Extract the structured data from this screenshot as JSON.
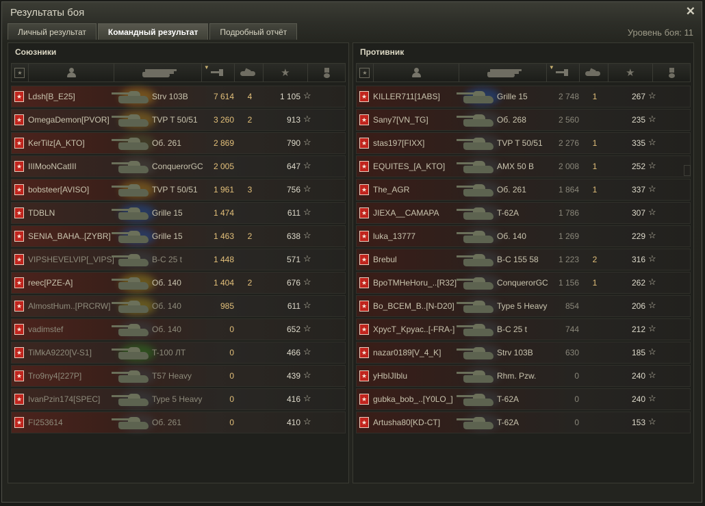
{
  "window": {
    "title": "Результаты боя",
    "close": "✕",
    "level": "Уровень боя: 11"
  },
  "tabs": [
    {
      "label": "Личный результат"
    },
    {
      "label": "Командный результат"
    },
    {
      "label": "Подробный отчёт"
    }
  ],
  "allies": {
    "title": "Союзники",
    "rows": [
      {
        "player": "Ldsh[B_E25]",
        "tank": "Strv 103B",
        "damage": "7 614",
        "kills": "4",
        "xp": "1 105",
        "glow": "#b08020"
      },
      {
        "player": "OmegaDemon[PVOR]",
        "tank": "TVP T 50/51",
        "damage": "3 260",
        "kills": "2",
        "xp": "913",
        "glow": "#a07a20"
      },
      {
        "player": "KerTilz[A_KTO]",
        "tank": "Об. 261",
        "damage": "2 869",
        "kills": "",
        "xp": "790",
        "glow": "#4a5530"
      },
      {
        "player": "IIIMooNCatIII",
        "tank": "ConquerorGC",
        "damage": "2 005",
        "kills": "",
        "xp": "647",
        "glow": "#4a4a44"
      },
      {
        "player": "bobsteer[AVISO]",
        "tank": "TVP T 50/51",
        "damage": "1 961",
        "kills": "3",
        "xp": "756",
        "glow": "#a07a20"
      },
      {
        "player": "TDBLN",
        "tank": "Grille 15",
        "damage": "1 474",
        "kills": "",
        "xp": "611",
        "glow": "#2050a0"
      },
      {
        "player": "SENIA_BAHA..[ZYBR]",
        "tank": "Grille 15",
        "damage": "1 463",
        "kills": "2",
        "xp": "638",
        "glow": "#2050a0"
      },
      {
        "player": "VIPSHEVELVIP[_VIPS]",
        "tank": "B-C 25 t",
        "damage": "1 448",
        "kills": "",
        "xp": "571",
        "glow": "#3a3f44",
        "dim": true
      },
      {
        "player": "reec[PZE-A]",
        "tank": "Об. 140",
        "damage": "1 404",
        "kills": "2",
        "xp": "676",
        "glow": "#9a8a20"
      },
      {
        "player": "AlmostHum..[PRCRW]",
        "tank": "Об. 140",
        "damage": "985",
        "kills": "",
        "xp": "611",
        "glow": "#9a8a20",
        "dim": true
      },
      {
        "player": "vadimstef",
        "tank": "Об. 140",
        "damage": "0",
        "kills": "",
        "xp": "652",
        "glow": "#3a3f44",
        "dim": true
      },
      {
        "player": "TiMkA9220[V-S1]",
        "tank": "T-100 ЛТ",
        "damage": "0",
        "kills": "",
        "xp": "466",
        "glow": "#307a20",
        "dim": true
      },
      {
        "player": "Tro9ny4[227P]",
        "tank": "T57 Heavy",
        "damage": "0",
        "kills": "",
        "xp": "439",
        "glow": "#3a3f44",
        "dim": true
      },
      {
        "player": "IvanPzin174[SPEC]",
        "tank": "Type 5 Heavy",
        "damage": "0",
        "kills": "",
        "xp": "416",
        "glow": "#3a3f44",
        "dim": true
      },
      {
        "player": "FI253614",
        "tank": "Об. 261",
        "damage": "0",
        "kills": "",
        "xp": "410",
        "glow": "#3a3f44",
        "dim": true
      }
    ]
  },
  "enemies": {
    "title": "Противник",
    "rows": [
      {
        "player": "KILLER711[1ABS]",
        "tank": "Grille 15",
        "damage": "2 748",
        "kills": "1",
        "xp": "267",
        "glow": "#2050a0"
      },
      {
        "player": "Sany7[VN_TG]",
        "tank": "Об. 268",
        "damage": "2 560",
        "kills": "",
        "xp": "235",
        "glow": "#3a3f44"
      },
      {
        "player": "stas197[FIXX]",
        "tank": "TVP T 50/51",
        "damage": "2 276",
        "kills": "1",
        "xp": "335",
        "glow": "#3a3f44"
      },
      {
        "player": "EQUITES_[A_KTO]",
        "tank": "AMX 50 B",
        "damage": "2 008",
        "kills": "1",
        "xp": "252",
        "glow": "#3a3f44"
      },
      {
        "player": "The_AGR",
        "tank": "Об. 261",
        "damage": "1 864",
        "kills": "1",
        "xp": "337",
        "glow": "#3a3f44"
      },
      {
        "player": "JIEXA__CAMAPA",
        "tank": "T-62A",
        "damage": "1 786",
        "kills": "",
        "xp": "307",
        "glow": "#3a3f44"
      },
      {
        "player": "luka_13777",
        "tank": "Об. 140",
        "damage": "1 269",
        "kills": "",
        "xp": "229",
        "glow": "#3a3f44"
      },
      {
        "player": "Brebul",
        "tank": "B-C 155 58",
        "damage": "1 223",
        "kills": "2",
        "xp": "316",
        "glow": "#3a3f44"
      },
      {
        "player": "BpoTMHeHoru_..[R32]",
        "tank": "ConquerorGC",
        "damage": "1 156",
        "kills": "1",
        "xp": "262",
        "glow": "#3a3f44"
      },
      {
        "player": "Bo_BCEM_B..[N-D20]",
        "tank": "Type 5 Heavy",
        "damage": "854",
        "kills": "",
        "xp": "206",
        "glow": "#3a3f44"
      },
      {
        "player": "XpycT_Kpyac..[-FRA-]",
        "tank": "B-C 25 t",
        "damage": "744",
        "kills": "",
        "xp": "212",
        "glow": "#3a3f44"
      },
      {
        "player": "nazar0189[V_4_K]",
        "tank": "Strv 103B",
        "damage": "630",
        "kills": "",
        "xp": "185",
        "glow": "#3a3f44"
      },
      {
        "player": "yHbIJIblu",
        "tank": "Rhm. Pzw.",
        "damage": "0",
        "kills": "",
        "xp": "240",
        "glow": "#3a3f44"
      },
      {
        "player": "gubka_bob_..[Y0LO_]",
        "tank": "T-62A",
        "damage": "0",
        "kills": "",
        "xp": "240",
        "glow": "#3a3f44"
      },
      {
        "player": "Artusha80[KD-CT]",
        "tank": "T-62A",
        "damage": "0",
        "kills": "",
        "xp": "153",
        "glow": "#3a3f44"
      }
    ]
  },
  "icons": [
    "squad-icon",
    "player-icon",
    "tank-icon",
    "damage-icon",
    "kills-icon",
    "xp-star-icon",
    "medal-icon"
  ],
  "colors": {
    "platoon_badge": "#c0241d",
    "damage_highlight": "#e3c07a"
  }
}
